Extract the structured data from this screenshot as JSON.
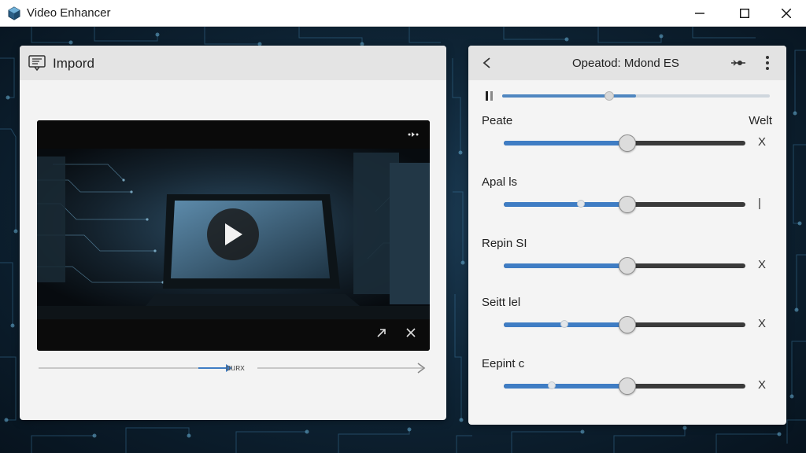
{
  "window": {
    "title": "Video Enhancer"
  },
  "left_panel": {
    "title": "Impord",
    "timeline_label": "ɑuʀx"
  },
  "right_panel": {
    "title": "Opeatod: Mdond ES",
    "top_progress": 0.5,
    "top_marker": 0.4,
    "right_label": "Welt",
    "rows": [
      {
        "label": "Peate",
        "value": 0.51,
        "marker": null,
        "end_symbol": "X"
      },
      {
        "label": "Apal ls",
        "value": 0.51,
        "marker": 0.32,
        "end_symbol": "|"
      },
      {
        "label": "Repin SI",
        "value": 0.51,
        "marker": null,
        "end_symbol": "X"
      },
      {
        "label": "Seitt lel",
        "value": 0.51,
        "marker": 0.25,
        "end_symbol": "X"
      },
      {
        "label": "Eepint c",
        "value": 0.51,
        "marker": 0.2,
        "end_symbol": "X"
      }
    ]
  },
  "colors": {
    "accent": "#3f7dc4",
    "background": "#0f2638"
  }
}
